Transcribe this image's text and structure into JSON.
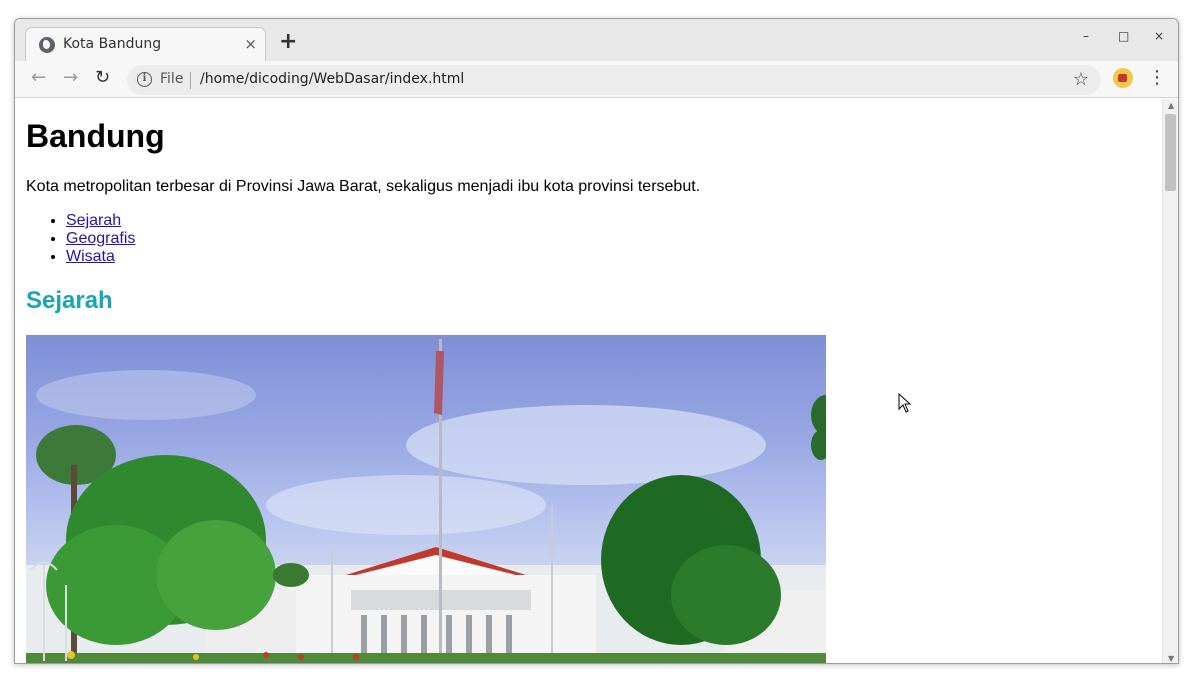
{
  "browser": {
    "tab_title": "Kota Bandung",
    "tab_close": "×",
    "new_tab": "+",
    "window_controls": {
      "minimize": "–",
      "maximize": "□",
      "close": "×"
    },
    "scheme_label": "File",
    "url": "/home/dicoding/WebDasar/index.html",
    "icons": [
      "globe-icon",
      "back-icon",
      "forward-icon",
      "reload-icon",
      "info-icon",
      "star-icon",
      "extension-icon",
      "menu-icon"
    ]
  },
  "page": {
    "heading": "Bandung",
    "intro": "Kota metropolitan terbesar di Provinsi Jawa Barat, sekaligus menjadi ibu kota provinsi tersebut.",
    "nav_links": [
      "Sejarah",
      "Geografis",
      "Wisata"
    ],
    "section_heading": "Sejarah",
    "section_color": "#1aa5b5",
    "link_color": "#2a13a0"
  }
}
